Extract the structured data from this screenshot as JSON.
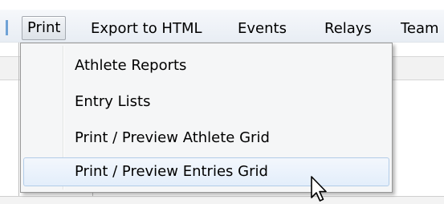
{
  "menubar": {
    "items": [
      {
        "label": "Print",
        "active": true
      },
      {
        "label": "Export to HTML",
        "active": false
      },
      {
        "label": "Events",
        "active": false
      },
      {
        "label": "Relays",
        "active": false
      },
      {
        "label": "Team",
        "active": false
      }
    ]
  },
  "dropdown": {
    "items": [
      {
        "label": "Athlete Reports"
      },
      {
        "label": "Entry Lists"
      },
      {
        "label": "Print / Preview Athlete Grid"
      },
      {
        "label": "Print / Preview Entries Grid",
        "hovered": true
      }
    ]
  },
  "colors": {
    "menubar_bg": "#edf1f6",
    "dropdown_bg": "#f5f6f7",
    "hover_border": "#b2cce8",
    "hover_bg": "#e8f1fb",
    "menubar_edge_accent": "#6fa2d6"
  },
  "icons": {
    "cursor": "mouse-pointer-icon"
  }
}
